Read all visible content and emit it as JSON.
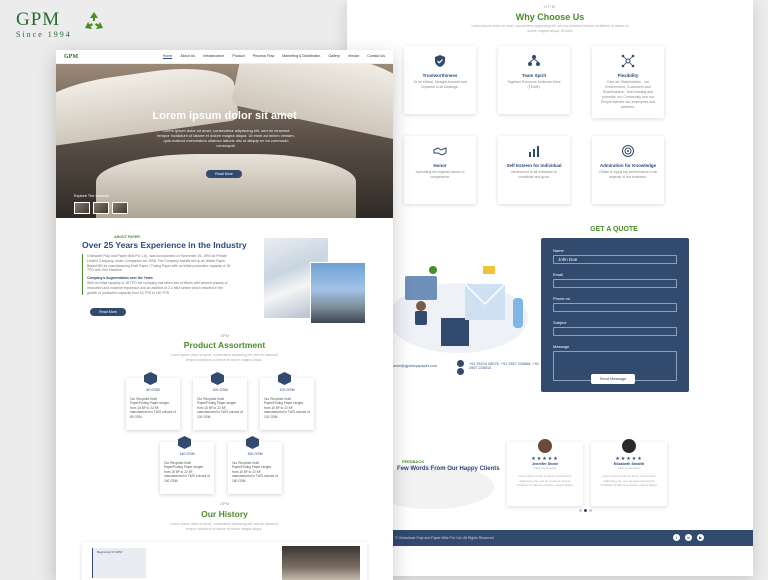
{
  "brand": {
    "name": "GPM",
    "since": "Since 1994",
    "logo_color": "#2b6a2f"
  },
  "colors": {
    "navy": "#314a6e",
    "green": "#4a8c2a"
  },
  "back_page": {
    "why": {
      "tag": "GPM",
      "title": "Why Choose Us",
      "subtitle": "Lorem ipsum dolor sit amet, consectetur adipiscing elit, sed do eiusmod tempor incididunt ut labore et dolore magna aliqua. Ut enim",
      "cards": [
        {
          "icon": "shield-check-icon",
          "title": "Trustworthiness",
          "desc": "To be ethical, Straight-forward and Impartial in all Dealings."
        },
        {
          "icon": "team-icon",
          "title": "Team Spirit",
          "desc": "Together Everyone Achieves More (TEAM)."
        },
        {
          "icon": "network-icon",
          "title": "Flexibility",
          "desc": "Care for Stakeholders - our Environment, Customers and Shareholders - both existing and potential, our Community and our People that are our employees and partners."
        },
        {
          "icon": "handshake-icon",
          "title": "Honor",
          "desc": "Upholding the highest values of competence."
        },
        {
          "icon": "chart-icon",
          "title": "Self Esteem for Individual",
          "desc": "Benevolent to all individual to contribute and grow."
        },
        {
          "icon": "target-icon",
          "title": "Admiration for Knowledge",
          "desc": "Obtain & Apply top performance in all aspects of our business."
        }
      ]
    },
    "quote": {
      "title": "GET A QUOTE",
      "fields": [
        {
          "label": "Name",
          "value": "John Doe"
        },
        {
          "label": "Email",
          "value": ""
        },
        {
          "label": "Phone no",
          "value": ""
        },
        {
          "label": "Subject",
          "value": ""
        }
      ],
      "message_label": "Message",
      "submit": "Send Message",
      "phone": "+91 99210 08075, +91 2557 226888, +91 2557 226813",
      "email": "gpbaran@gpdiaryapaper.com"
    },
    "testimonials": {
      "tag": "FEEDBACK",
      "title": "Few Words From Our Happy Clients",
      "items": [
        {
          "stars": "★★★★★",
          "name": "Jennifer Stone",
          "role": "CEO of company",
          "text": "Lorem ipsum dolor sit amet, consectetur adipiscing elit, sed do eiusmod tempor incididunt ut labore et dolore magna aliqua."
        },
        {
          "stars": "★★★★★",
          "name": "Elizabeth Smalth",
          "role": "CEO of company",
          "text": "Lorem ipsum dolor sit amet, consectetur adipiscing elit, sed do eiusmod tempor incididunt ut labore et dolore magna aliqua."
        }
      ]
    },
    "footer": {
      "copyright": "© Goteshwar Pulp and Paper Mills Pvt. Ltd. All Rights Reserved"
    }
  },
  "front_page": {
    "nav": {
      "logo": "GPM",
      "items": [
        "Home",
        "About Us",
        "Infrastructure",
        "Product",
        "Process Flow",
        "Marketing & Distribution",
        "Gallery",
        "Vendor",
        "Contact Us"
      ]
    },
    "hero": {
      "title": "Lorem ipsum dolor sit amet",
      "text": "Lorem ipsum dolor sit amet, consectetur adipiscing elit, sed do eiusmod tempor incididunt ut labore et dolore magna aliqua. Ut enim ad minim veniam, quis nostrud exercitation ullamco laboris nisi ut aliquip ex ea commodo consequat.",
      "button": "Read More",
      "explore": "Explore The Industry"
    },
    "about": {
      "tag": "ABOUT PAPER",
      "title": "Over 25 Years Experience in the Industry",
      "text": "Goteswari Pulp and Paper Mills Pvt. Ltd., was incorporated on November 26, 1994 as Private Limited Company, under Companies act 1956. The Company installs set up as Waste Paper Based Mill for manufacturing Kraft Paper / Fluting Paper with an initial production capacity of 18 TPD with One Machine.",
      "sub_title": "Company's Augmentation over the Years",
      "sub_text": "With an initial capacity of 18 TPD the company has taken lots of efforts with several phases of innovation and machine expansion and an addition of 2.2 MW turbine which resulted in the growth of production capacity from 18 TPD to 160 TPD.",
      "button": "Read More"
    },
    "products": {
      "tag": "GPM",
      "title": "Product Assortment",
      "subtitle": "Lorem ipsum dolor sit amet, consectetur adipiscing elit, sed do eiusmod tempor incididunt ut labore et dolore magna aliqua.",
      "items": [
        {
          "name": "80 GSM",
          "desc": "Our Recycled Kraft Paper/Fluting Paper ranges from 16 BF to 22 BF, manufactured in TWO colours of 80 GSM."
        },
        {
          "name": "100 GSM",
          "desc": "Our Recycled Kraft Paper/Fluting Paper ranges from 16 BF to 22 BF, manufactured in TWO colours of 100 GSM."
        },
        {
          "name": "120 GSM",
          "desc": "Our Recycled Kraft Paper/Fluting Paper ranges from 16 BF to 22 BF, manufactured in TWO colours of 120 GSM."
        },
        {
          "name": "140 GSM",
          "desc": "Our Recycled Kraft Paper/Fluting Paper ranges from 16 BF to 22 BF, manufactured in TWO colours of 140 GSM."
        },
        {
          "name": "160 GSM",
          "desc": "Our Recycled Kraft Paper/Fluting Paper ranges from 16 BF to 22 BF, manufactured in TWO colours of 160 GSM."
        }
      ]
    },
    "history": {
      "tag": "GPM",
      "title": "Our History",
      "subtitle": "Lorem ipsum dolor sit amet, consectetur adipiscing elit, sed do eiusmod tempor incididunt ut labore et dolore magna aliqua.",
      "card_label": "Beginning Of GPM"
    }
  }
}
